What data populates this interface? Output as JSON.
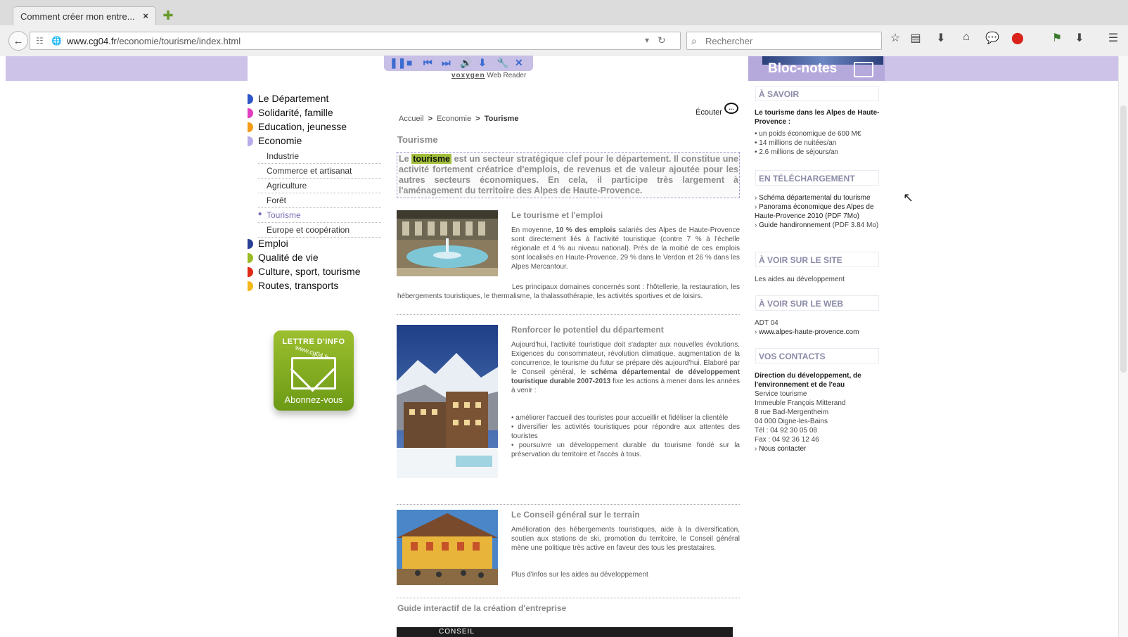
{
  "browser": {
    "tab_title": "Comment créer mon entre...",
    "tab_close": "×",
    "new_tab": "✚",
    "url_domain": "www.cg04.fr",
    "url_path": "/economie/tourisme/index.html",
    "search_placeholder": "Rechercher",
    "toolbar_icons": [
      "star-icon",
      "reader-icon",
      "download-icon",
      "home-icon",
      "chat-icon",
      "adblock-icon",
      "extension-icon",
      "download-arrow-icon",
      "menu-icon"
    ]
  },
  "voxygen": {
    "logo": "voxygen",
    "suffix": "Web Reader",
    "controls": [
      "pause",
      "stop",
      "prev",
      "next",
      "volume",
      "download",
      "settings",
      "close"
    ]
  },
  "menu": {
    "items": [
      {
        "label": "Le Département",
        "color": "#2f56c8"
      },
      {
        "label": "Solidarité, famille",
        "color": "#e03fc0"
      },
      {
        "label": "Education, jeunesse",
        "color": "#f49b18"
      },
      {
        "label": "Economie",
        "color": "#b9acea"
      }
    ],
    "sub": [
      "Industrie",
      "Commerce et artisanat",
      "Agriculture",
      "Forêt",
      "Tourisme",
      "Europe et coopération"
    ],
    "items2": [
      {
        "label": "Emploi",
        "color": "#2a3f96"
      },
      {
        "label": "Qualité de vie",
        "color": "#9bbb26"
      },
      {
        "label": "Culture, sport, tourisme",
        "color": "#e02a1a"
      },
      {
        "label": "Routes, transports",
        "color": "#f5b81a"
      }
    ]
  },
  "lettre": {
    "title": "LETTRE D'INFO",
    "site": "www.cg04.fr",
    "cta": "Abonnez-vous"
  },
  "breadcrumb": {
    "home": "Accueil",
    "sep": ">",
    "economie": "Economie",
    "current": "Tourisme"
  },
  "ecouter": "Écouter",
  "page_title": "Tourisme",
  "intro": {
    "lead": "Le ",
    "highlight": "tourisme",
    "rest": " est un secteur stratégique clef pour le département. Il constitue une activité fortement créatrice d'emplois, de revenus et de valeur ajoutée pour les autres secteurs économiques. En cela, il participe très largement à l'aménagement du territoire des Alpes de Haute-Provence."
  },
  "articles": [
    {
      "title": "Le tourisme et l'emploi",
      "p1a": "En moyenne, ",
      "p1b": "10 % des emplois",
      "p1c": " salariés des Alpes de Haute-Provence sont directement liés à l'activité touristique (contre 7 % à l'échelle régionale et 4 % au niveau national). Près de la moitié de ces emplois sont localisés en Haute-Provence, 29 % dans le Verdon et 26 % dans les Alpes Mercantour.",
      "p2": "Les principaux domaines concernés sont : l'hôtellerie, la restauration, les hébergements touristiques, le thermalisme, la thalassothérapie, les activités sportives et de loisirs."
    },
    {
      "title": "Renforcer le potentiel du département",
      "p1a": "Aujourd'hui, l'activité touristique doit s'adapter aux nouvelles évolutions. Exigences du consommateur, révolution climatique, augmentation de la concurrence, le tourisme du futur se prépare dès aujourd'hui. Élaboré par le Conseil général, le ",
      "p1b": "schéma départemental de développement touristique durable 2007-2013",
      "p1c": " fixe les actions à mener dans les années à venir :",
      "bullets": [
        "• améliorer l'accueil des touristes pour accueillir et fidéliser la clientèle",
        "• diversifier les activités touristiques pour répondre aux attentes des touristes",
        "• poursuivre un développement durable du tourisme fondé sur la préservation du territoire et l'accès à tous."
      ]
    },
    {
      "title": "Le Conseil général sur le terrain",
      "p1": "Amélioration des hébergements touristiques, aide à la diversification, soutien aux stations de ski, promotion du territoire, le Conseil général mène une politique très active en faveur des tous les prestataires.",
      "p2": "Plus d'infos sur les aides au développement"
    }
  ],
  "guide_title": "Guide interactif de la création d'entreprise",
  "conseil_banner": "CONSEIL",
  "sidebar": {
    "title": "Bloc-notes",
    "savoir_title": "À SAVOIR",
    "savoir_head": "Le tourisme dans les Alpes de Haute-Provence :",
    "savoir_items": [
      "• un poids économique de 600 M€",
      "• 14 millions de nuitées/an",
      "• 2.6 millions de séjours/an"
    ],
    "telech_title": "EN TÉLÉCHARGEMENT",
    "telech_items": [
      "Schéma départemental du tourisme",
      "Panorama économique des Alpes de Haute-Provence 2010 (PDF 7Mo)"
    ],
    "telech_guide": "Guide handironnement",
    "telech_guide_size": " (PDF 3.84 Mo)",
    "site_title": "À VOIR SUR LE SITE",
    "site_item": "Les aides au développement",
    "web_title": "À VOIR SUR LE WEB",
    "web_name": "ADT 04",
    "web_link": "www.alpes-haute-provence.com",
    "contacts_title": "VOS CONTACTS",
    "contact_head": "Direction du développement, de l'environnement et de l'eau",
    "contact_lines": [
      "Service tourisme",
      "Immeuble François Mitterand",
      "8 rue Bad-Mergentheim",
      "04 000 Digne-les-Bains",
      "Tél : 04 92 30 05 08",
      "Fax : 04 92 36 12 46"
    ],
    "contact_link": "Nous contacter"
  }
}
